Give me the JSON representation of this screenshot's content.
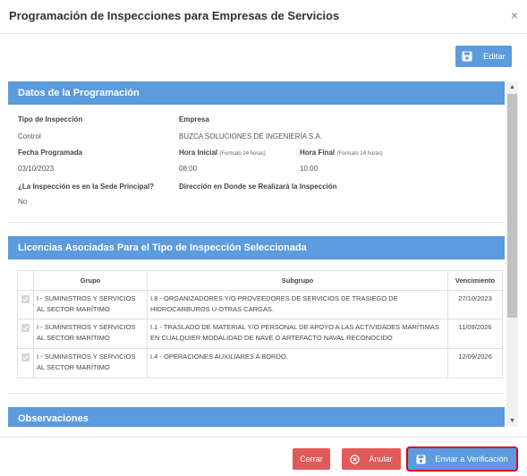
{
  "modal": {
    "title": "Programación de Inspecciones para Empresas de Servicios",
    "close": "×"
  },
  "toolbar": {
    "edit_label": "Editar"
  },
  "programacion": {
    "header": "Datos de la Programación",
    "tipo_label": "Tipo de Inspección",
    "tipo_value": "Control",
    "empresa_label": "Empresa",
    "empresa_value": "BUZCA SOLUCIONES DE INGENIERÍA S.A.",
    "fecha_label": "Fecha Programada",
    "fecha_value": "03/10/2023",
    "hora_inicial_label": "Hora Inicial",
    "hora_inicial_hint": "(Formato 24 horas)",
    "hora_inicial_value": "08:00",
    "hora_final_label": "Hora Final",
    "hora_final_hint": "(Formato 24 horas)",
    "hora_final_value": "10:00",
    "sede_label": "¿La Inspección es en la Sede Principal?",
    "sede_value": "No",
    "direccion_label": "Dirección en Donde se Realizará la Inspección",
    "direccion_value": ""
  },
  "licencias": {
    "header": "Licencias Asociadas Para el Tipo de Inspección Seleccionada",
    "columns": [
      "Grupo",
      "Subgrupo",
      "Vencimiento"
    ],
    "rows": [
      {
        "grupo": "I - SUMINISTROS Y SERVICIOS AL SECTOR MARÍTIMO",
        "subgrupo": "I.8 - ORGANIZADORES Y/O PROVEEDORES DE SERVICIOS DE TRASIEGO DE HIDROCARBUROS U OTRAS CARGAS.",
        "vencimiento": "27/10/2023",
        "checked": true
      },
      {
        "grupo": "I - SUMINISTROS Y SERVICIOS AL SECTOR MARÍTIMO",
        "subgrupo": "I.1 - TRASLADO DE MATERIAL Y/O PERSONAL DE APOYO A LAS ACTIVIDADES MARÍTIMAS EN CUALQUIER MODALIDAD DE NAVE O ARTEFACTO NAVAL RECONOCIDO",
        "vencimiento": "11/09/2026",
        "checked": true
      },
      {
        "grupo": "I - SUMINISTROS Y SERVICIOS AL SECTOR MARÍTIMO",
        "subgrupo": "I.4 - OPERACIONES AUXILIARES A BORDO.",
        "vencimiento": "12/09/2026",
        "checked": true
      }
    ]
  },
  "observaciones": {
    "header": "Observaciones"
  },
  "footer": {
    "cerrar": "Cerrar",
    "anular": "Anular",
    "enviar": "Enviar a Verificación"
  },
  "colors": {
    "accent": "#5b9bde",
    "danger": "#e2595a",
    "highlight": "#e00012"
  },
  "icons": {
    "edit_button": "save-icon",
    "anular_button": "circle-x-icon",
    "enviar_button": "save-icon"
  }
}
